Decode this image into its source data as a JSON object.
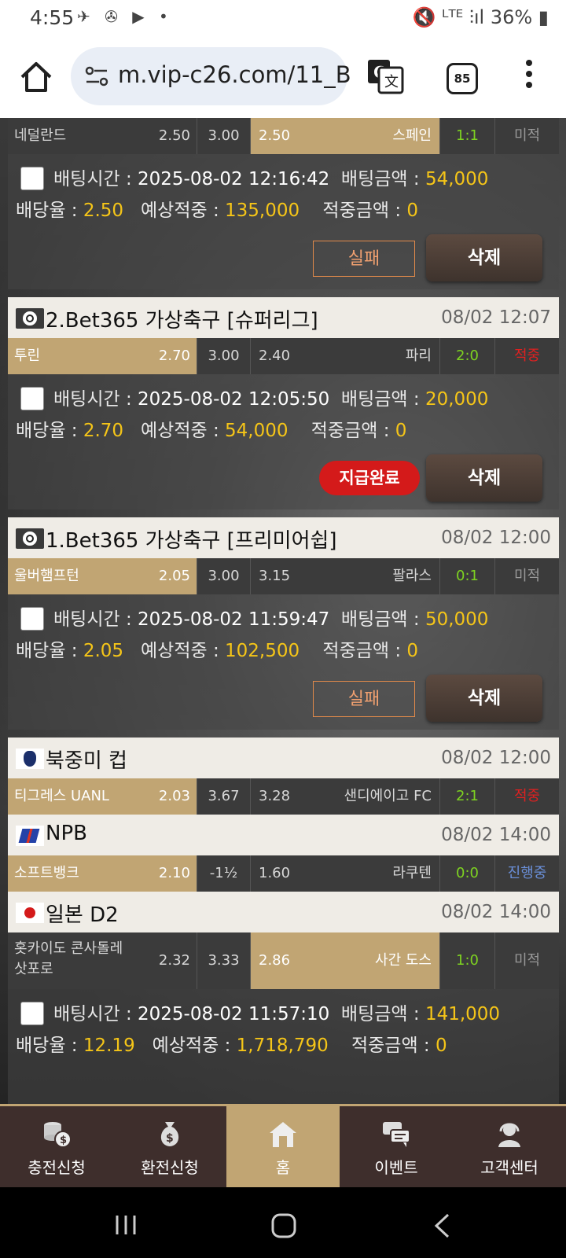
{
  "status_bar": {
    "time": "4:55",
    "notif_icons": "✈ ✇ ▶ •",
    "right": "🔇 ᴸᵀᴱ ⫶ıl 36% ▮"
  },
  "browser": {
    "url": "m.vip-c26.com/11_B",
    "tab_count": "85"
  },
  "top_row": {
    "home_team": "네덜란드",
    "home_odds": "2.50",
    "draw_odds": "3.00",
    "away_odds": "2.50",
    "away_team": "스페인",
    "score": "1:1",
    "result": "미적"
  },
  "bets": [
    {
      "time_label": "배팅시간 :",
      "time": "2025-08-02 12:16:42",
      "amount_label": "배팅금액 :",
      "amount": "54,000",
      "rate_label": "배당율 :",
      "rate": "2.50",
      "expected_label": "예상적중 :",
      "expected": "135,000",
      "win_label": "적중금액 :",
      "win": "0",
      "status_button": "실패",
      "delete_button": "삭제"
    },
    {
      "time_label": "배팅시간 :",
      "time": "2025-08-02 12:05:50",
      "amount_label": "배팅금액 :",
      "amount": "20,000",
      "rate_label": "배당율 :",
      "rate": "2.70",
      "expected_label": "예상적중 :",
      "expected": "54,000",
      "win_label": "적중금액 :",
      "win": "0",
      "status_button": "지급완료",
      "delete_button": "삭제"
    },
    {
      "time_label": "배팅시간 :",
      "time": "2025-08-02 11:59:47",
      "amount_label": "배팅금액 :",
      "amount": "50,000",
      "rate_label": "배당율 :",
      "rate": "2.05",
      "expected_label": "예상적중 :",
      "expected": "102,500",
      "win_label": "적중금액 :",
      "win": "0",
      "status_button": "실패",
      "delete_button": "삭제"
    },
    {
      "time_label": "배팅시간 :",
      "time": "2025-08-02 11:57:10",
      "amount_label": "배팅금액 :",
      "amount": "141,000",
      "rate_label": "배당율 :",
      "rate": "12.19",
      "expected_label": "예상적중 :",
      "expected": "1,718,790",
      "win_label": "적중금액 :",
      "win": "0"
    }
  ],
  "games": [
    {
      "league": "2.Bet365 가상축구 [슈퍼리그]",
      "datetime": "08/02 12:07",
      "home_team": "투린",
      "home_odds": "2.70",
      "draw_odds": "3.00",
      "away_odds": "2.40",
      "away_team": "파리",
      "score": "2:0",
      "result": "적중"
    },
    {
      "league": "1.Bet365 가상축구 [프리미어쉽]",
      "datetime": "08/02 12:00",
      "home_team": "울버햄프턴",
      "home_odds": "2.05",
      "draw_odds": "3.00",
      "away_odds": "3.15",
      "away_team": "팔라스",
      "score": "0:1",
      "result": "미적"
    },
    {
      "league": "북중미 컵",
      "datetime": "08/02 12:00",
      "home_team": "티그레스 UANL",
      "home_odds": "2.03",
      "draw_odds": "3.67",
      "away_odds": "3.28",
      "away_team": "샌디에이고 FC",
      "score": "2:1",
      "result": "적중"
    },
    {
      "league": "NPB",
      "datetime": "08/02 14:00",
      "home_team": "소프트뱅크",
      "home_odds": "2.10",
      "draw_odds": "-1½",
      "away_odds": "1.60",
      "away_team": "라쿠텐",
      "score": "0:0",
      "result": "진행중"
    },
    {
      "league": "일본 D2",
      "datetime": "08/02 14:00",
      "home_team_line1": "홋카이도 콘사돌레",
      "home_team_line2": "삿포로",
      "home_odds": "2.32",
      "draw_odds": "3.33",
      "away_odds": "2.86",
      "away_team": "사간 도스",
      "score": "1:0",
      "result": "미적"
    }
  ],
  "bottom_nav": [
    {
      "label": "충전신청",
      "icon": "coins-deposit-icon"
    },
    {
      "label": "환전신청",
      "icon": "money-bag-icon"
    },
    {
      "label": "홈",
      "icon": "home-icon"
    },
    {
      "label": "이벤트",
      "icon": "chat-bubbles-icon"
    },
    {
      "label": "고객센터",
      "icon": "support-agent-icon"
    }
  ],
  "colors": {
    "gold": "#c1a573",
    "yellow_value": "#f5c518",
    "win_green": "#7ed321",
    "hit_red": "#e02020",
    "nav_bg": "#3e2e2c"
  }
}
